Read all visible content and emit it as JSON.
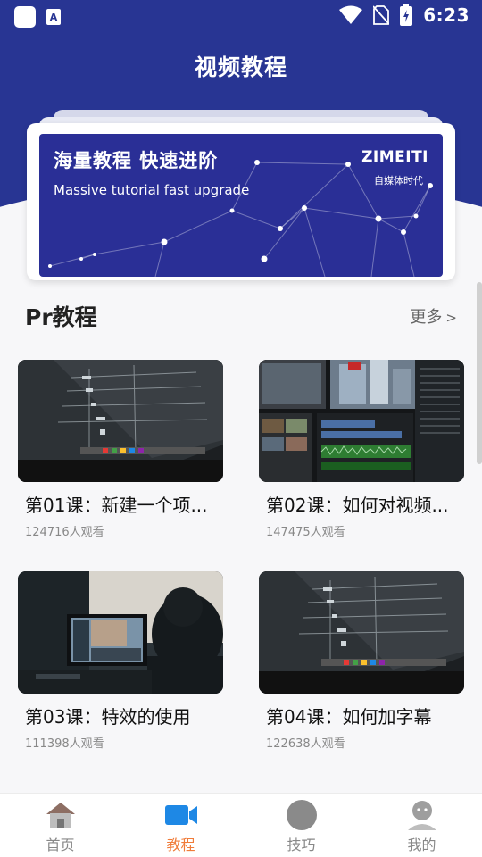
{
  "status_bar": {
    "time": "6:23"
  },
  "header": {
    "title": "视频教程"
  },
  "banner": {
    "headline": "海量教程  快速进阶",
    "subline": "Massive tutorial fast upgrade",
    "brand": "ZIMEITI",
    "brand_sub": "自媒体时代",
    "background_color": "#2a2f96"
  },
  "section": {
    "title": "Pr教程",
    "more_label": "更多",
    "more_icon": ">"
  },
  "courses": [
    {
      "title": "第01课：新建一个项...",
      "views": "124716人观看"
    },
    {
      "title": "第02课：如何对视频...",
      "views": "147475人观看"
    },
    {
      "title": "第03课：特效的使用",
      "views": "111398人观看"
    },
    {
      "title": "第04课：如何加字幕",
      "views": "122638人观看"
    }
  ],
  "bottom_nav": [
    {
      "label": "首页",
      "icon": "home-icon"
    },
    {
      "label": "教程",
      "icon": "video-camera-icon",
      "active": true
    },
    {
      "label": "技巧",
      "icon": "compass-icon"
    },
    {
      "label": "我的",
      "icon": "user-icon"
    }
  ],
  "colors": {
    "primary": "#283593",
    "accent": "#f07c3a",
    "nav_icon_active": "#1e88e5"
  }
}
